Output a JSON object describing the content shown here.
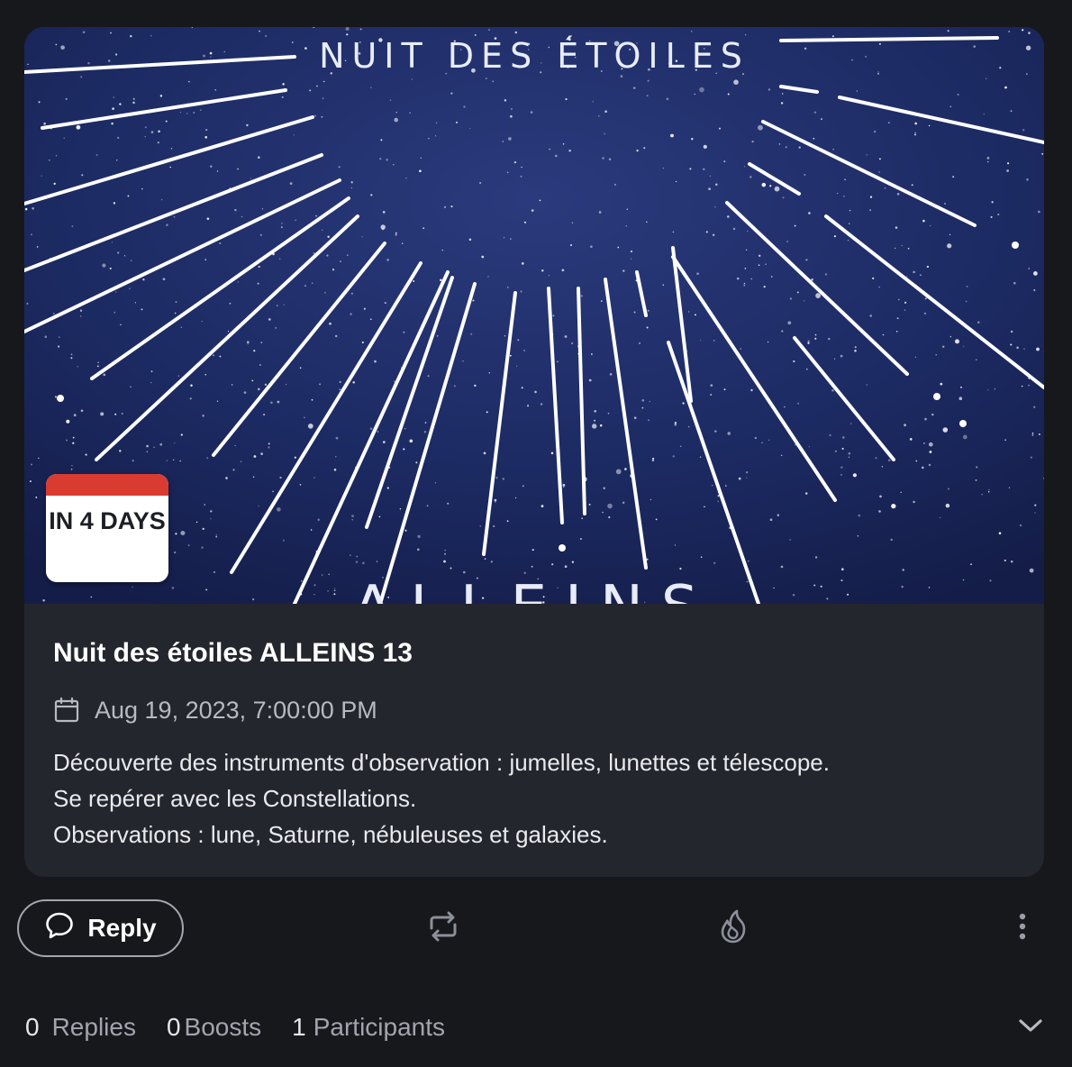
{
  "event": {
    "banner_title": "NUIT DES ÉTOILES",
    "banner_subtitle": "ALLEINS",
    "countdown_label": "IN 4 DAYS",
    "title": "Nuit des étoiles ALLEINS 13",
    "datetime": "Aug 19, 2023, 7:00:00 PM",
    "description": [
      "Découverte des instruments d'observation : jumelles, lunettes et télescope.",
      "Se repérer avec les Constellations.",
      "Observations : lune, Saturne, nébuleuses et galaxies."
    ]
  },
  "actions": {
    "reply_label": "Reply",
    "icons": [
      "reply-icon",
      "boost-icon",
      "favourite-icon",
      "more-icon",
      "chevron-down-icon"
    ]
  },
  "stats": {
    "replies": {
      "count": "0",
      "label": "Replies"
    },
    "boosts": {
      "count": "0",
      "label": "Boosts"
    },
    "participants": {
      "count": "1",
      "label": "Participants"
    }
  },
  "colors": {
    "background": "#17181c",
    "card": "#24262d",
    "badge_accent": "#d93b30",
    "sky": "#1b2a63"
  }
}
